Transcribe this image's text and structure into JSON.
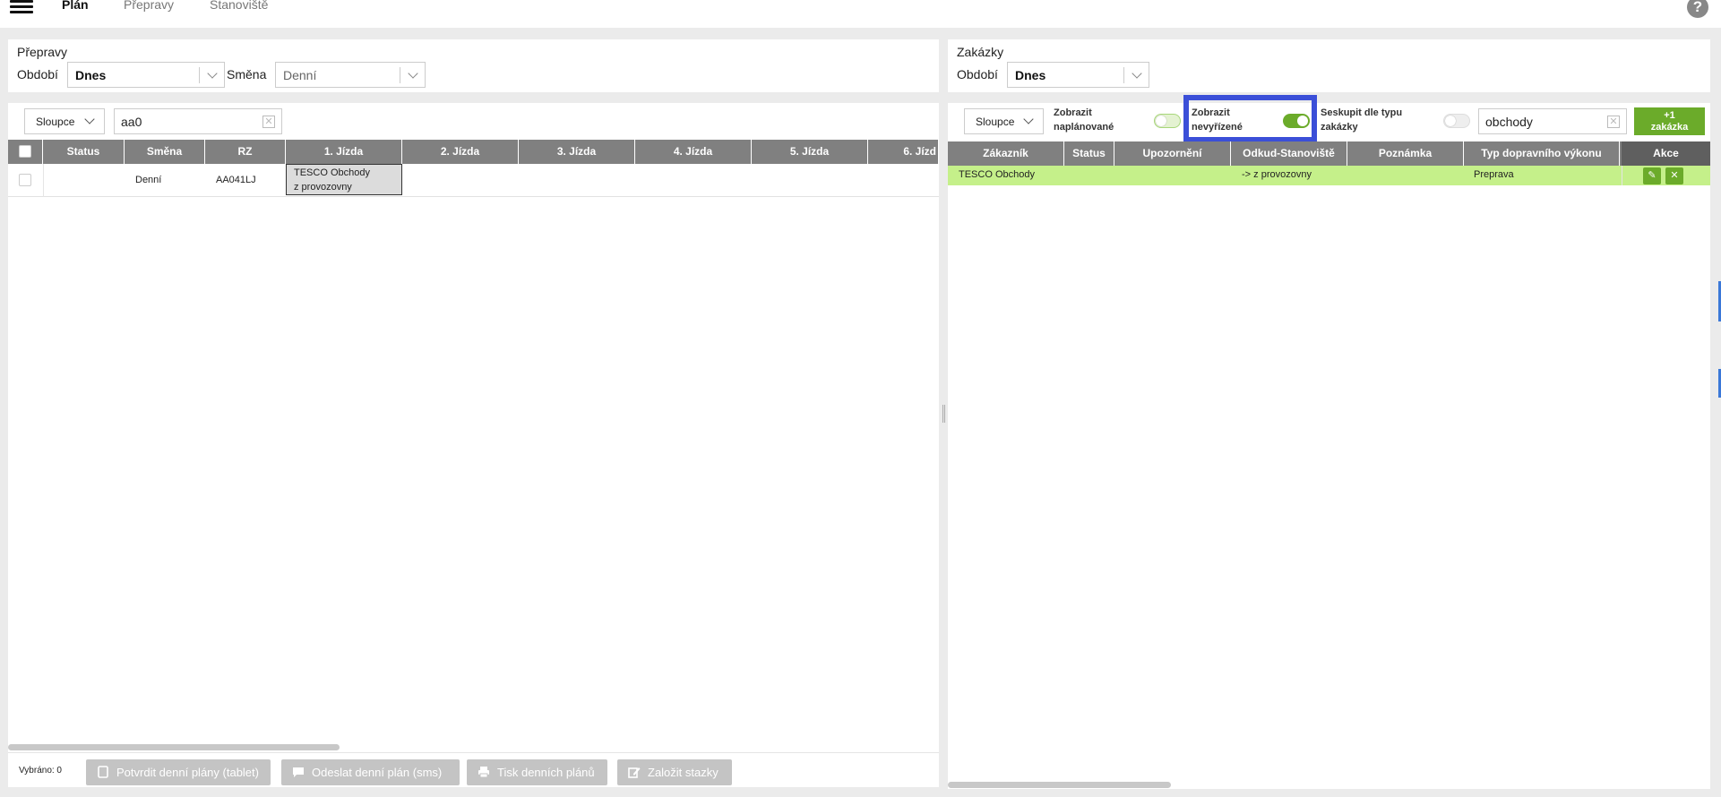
{
  "nav": {
    "tabs": [
      "Plán",
      "Přepravy",
      "Stanoviště"
    ],
    "help": "?"
  },
  "left": {
    "filter": {
      "title": "Přepravy",
      "period_label": "Období",
      "period_value": "Dnes",
      "shift_label": "Směna",
      "shift_value": "Denní"
    },
    "toolbar": {
      "columns_label": "Sloupce",
      "search_value": "aa0"
    },
    "table": {
      "headers": [
        "Status",
        "Směna",
        "RZ",
        "1. Jízda",
        "2. Jízda",
        "3. Jízda",
        "4. Jízda",
        "5. Jízda",
        "6. Jízd"
      ],
      "rows": [
        {
          "status": "",
          "smena": "Denní",
          "rz": "AA041LJ",
          "jizda1_line1": "TESCO Obchody",
          "jizda1_line2": "z provozovny"
        }
      ]
    },
    "footer": {
      "selected": "Vybráno: 0",
      "buttons": [
        "Potvrdit denní plány (tablet)",
        "Odeslat denní plán (sms)",
        "Tisk denních plánů",
        "Založit stazky"
      ]
    }
  },
  "right": {
    "filter": {
      "title": "Zakázky",
      "period_label": "Období",
      "period_value": "Dnes"
    },
    "toolbar": {
      "columns_label": "Sloupce",
      "toggle_planned_l1": "Zobrazit",
      "toggle_planned_l2": "naplánované",
      "toggle_unresolved_l1": "Zobrazit",
      "toggle_unresolved_l2": "nevyřízené",
      "toggle_group_l1": "Seskupit dle typu",
      "toggle_group_l2": "zakázky",
      "search_value": "obchody",
      "add_l1": "+1",
      "add_l2": "zakázka"
    },
    "toggles": {
      "planned": false,
      "unresolved": true,
      "group": false
    },
    "table": {
      "headers": [
        "Zákazník",
        "Status",
        "Upozornění",
        "Odkud-Stanoviště",
        "Poznámka",
        "Typ dopravního výkonu",
        "Akce"
      ],
      "rows": [
        {
          "zakaznik": "TESCO Obchody",
          "status": "",
          "upozorneni": "",
          "odkud": "-> z provozovny",
          "poznamka": "",
          "typ": "Preprava"
        }
      ]
    }
  },
  "colors": {
    "header_gray": "#808080",
    "accent_green": "#6bab2a",
    "row_highlight": "#c5f08a",
    "highlight_box": "#3b4fd8",
    "disabled_button": "#c4c4c4"
  }
}
